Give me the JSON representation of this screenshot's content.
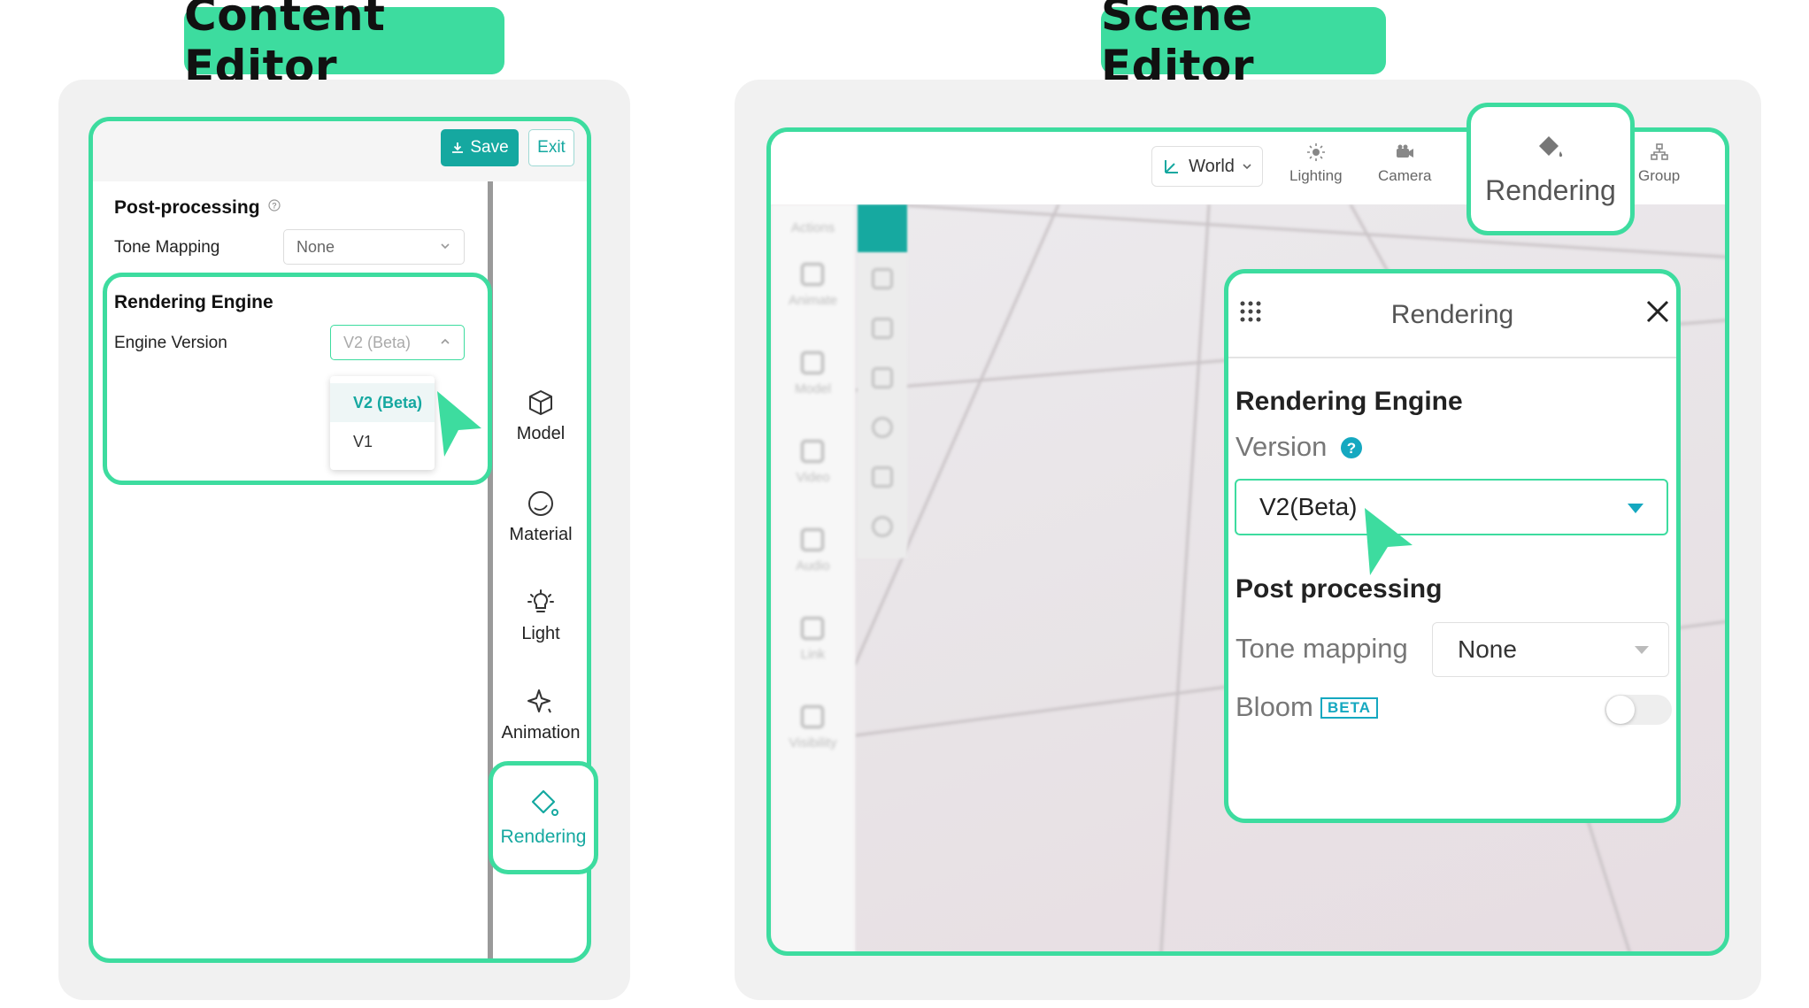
{
  "content_editor": {
    "heading": "Content Editor",
    "toolbar": {
      "save_label": "Save",
      "exit_label": "Exit"
    },
    "post_processing": {
      "title": "Post-processing",
      "tone_mapping_label": "Tone Mapping",
      "tone_mapping_value": "None"
    },
    "rendering_engine": {
      "title": "Rendering Engine",
      "engine_version_label": "Engine Version",
      "engine_version_value": "V2 (Beta)",
      "options": [
        "V2 (Beta)",
        "V1"
      ]
    },
    "side_nav": {
      "items": [
        {
          "label": "Model",
          "icon": "cube-icon"
        },
        {
          "label": "Material",
          "icon": "sphere-icon"
        },
        {
          "label": "Light",
          "icon": "bulb-icon"
        },
        {
          "label": "Animation",
          "icon": "sparkle-icon"
        },
        {
          "label": "Rendering",
          "icon": "paint-bucket-icon"
        }
      ]
    }
  },
  "scene_editor": {
    "heading": "Scene Editor",
    "toolbar": {
      "world_label": "World",
      "lighting_label": "Lighting",
      "camera_label": "Camera",
      "rendering_label": "Rendering",
      "group_label": "Group"
    },
    "left_rail": {
      "title": "Actions",
      "items": [
        "Animate",
        "Model",
        "Video",
        "Audio",
        "Link",
        "Visibility"
      ]
    },
    "rendering_dialog": {
      "title": "Rendering",
      "engine_heading": "Rendering Engine",
      "version_label": "Version",
      "version_value": "V2(Beta)",
      "post_heading": "Post processing",
      "tone_mapping_label": "Tone mapping",
      "tone_mapping_value": "None",
      "bloom_label": "Bloom",
      "bloom_badge": "BETA"
    }
  },
  "colors": {
    "highlight_green": "#3ddc9f",
    "teal_accent": "#15a8a0"
  }
}
